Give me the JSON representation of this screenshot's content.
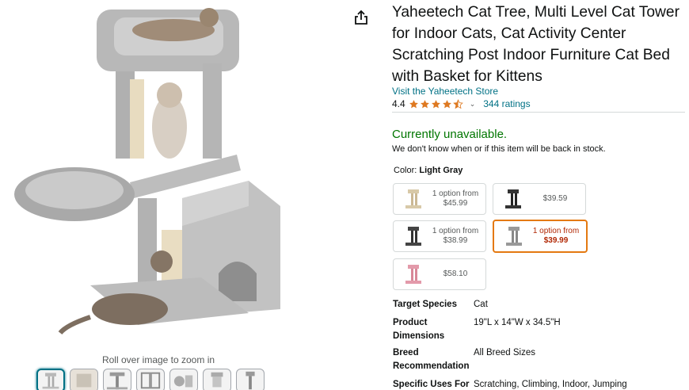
{
  "product": {
    "title": "Yaheetech Cat Tree, Multi Level Cat Tower for Indoor Cats, Cat Activity Center Scratching Post Indoor Furniture Cat Bed with Basket for Kittens",
    "store_link": "Visit the Yaheetech Store",
    "rating_value": "4.4",
    "rating_stars": 4.4,
    "ratings_count": "344 ratings"
  },
  "gallery": {
    "zoom_hint": "Roll over image to zoom in",
    "thumbnail_count": 7
  },
  "availability": {
    "status": "Currently unavailable.",
    "note": "We don't know when or if this item will be back in stock."
  },
  "color": {
    "label": "Color: ",
    "selected": "Light Gray"
  },
  "swatches": [
    {
      "option": "1 option from",
      "price": "$45.99",
      "tone": "beige"
    },
    {
      "option": "",
      "price": "$39.59",
      "tone": "black"
    },
    {
      "option": "1 option from",
      "price": "$38.99",
      "tone": "dark"
    },
    {
      "option": "1 option from",
      "price": "$39.99",
      "tone": "gray",
      "selected": true
    },
    {
      "option": "",
      "price": "$58.10",
      "tone": "pink"
    }
  ],
  "specs": [
    {
      "key": "Target Species",
      "value": "Cat"
    },
    {
      "key": "Product Dimensions",
      "value": "19\"L x 14\"W x 34.5\"H"
    },
    {
      "key": "Breed Recommendation",
      "value": "All Breed Sizes"
    },
    {
      "key": "Specific Uses For",
      "value": "Scratching, Climbing, Indoor, Jumping"
    }
  ],
  "colors": {
    "link": "#007185",
    "available_green": "#007600",
    "selected_border": "#e47911",
    "selected_price": "#b12704",
    "star": "#de7921"
  }
}
